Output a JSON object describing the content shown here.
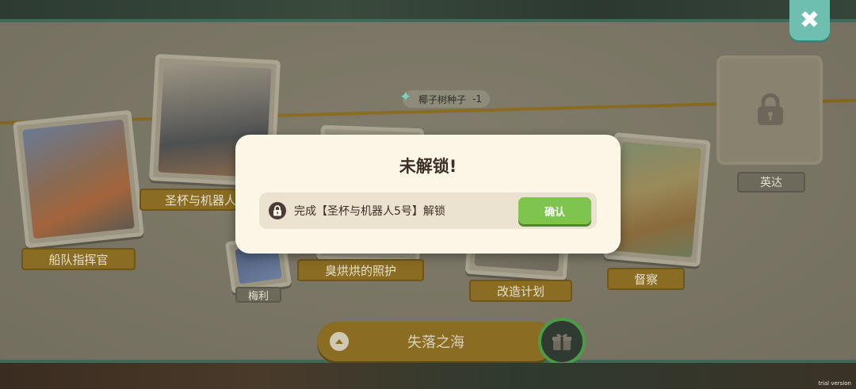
{
  "close": {
    "glyph": "✖",
    "icon": "close-icon"
  },
  "reward": {
    "item": "椰子树种子",
    "amount": "-1",
    "icon": "sparkle-icon"
  },
  "cards": [
    {
      "id": "commander",
      "label": "船队指挥官"
    },
    {
      "id": "grail-robot",
      "label": "圣杯与机器人"
    },
    {
      "id": "smelly-care",
      "label": "臭烘烘的照护"
    },
    {
      "id": "rebuild-plan",
      "label": "改造计划"
    },
    {
      "id": "supervise",
      "label": "督察"
    },
    {
      "id": "yingda",
      "label": "英达"
    }
  ],
  "small_card": {
    "label": "梅利"
  },
  "region": {
    "name": "失落之海",
    "up_icon": "chevron-up-icon",
    "gift_icon": "gift-icon"
  },
  "modal": {
    "title": "未解锁!",
    "requirement": "完成【圣杯与机器人5号】解锁",
    "confirm": "确认",
    "lock_icon": "lock-icon"
  },
  "watermark": "trial version",
  "colors": {
    "modal_bg": "#fbf6e6",
    "confirm_green": "#7ec44e",
    "close_teal": "#6fbfb0",
    "label_gold": "#8a6c22"
  }
}
